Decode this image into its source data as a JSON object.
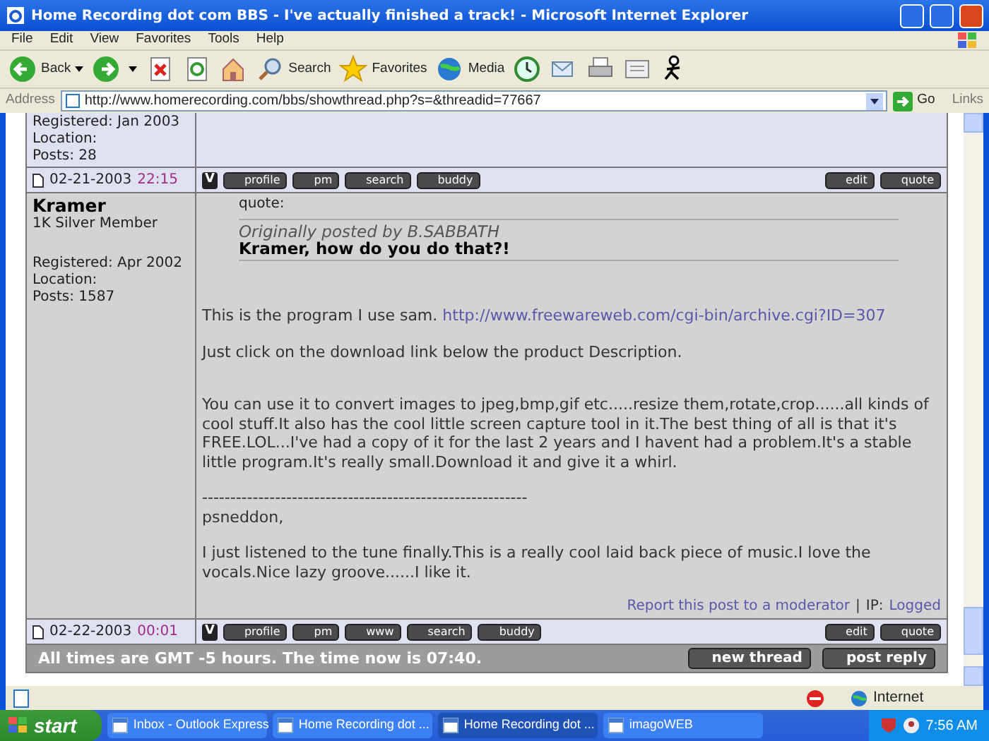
{
  "window": {
    "title": "Home Recording dot com BBS - I've actually finished a track! - Microsoft Internet Explorer"
  },
  "menu": [
    "File",
    "Edit",
    "View",
    "Favorites",
    "Tools",
    "Help"
  ],
  "toolbar": [
    {
      "kind": "back",
      "label": "Back"
    },
    {
      "kind": "forward"
    },
    {
      "kind": "stop"
    },
    {
      "kind": "refresh"
    },
    {
      "kind": "home"
    },
    {
      "kind": "search",
      "label": "Search"
    },
    {
      "kind": "favorites",
      "label": "Favorites"
    },
    {
      "kind": "media",
      "label": "Media"
    },
    {
      "kind": "history"
    },
    {
      "kind": "mail"
    },
    {
      "kind": "print"
    },
    {
      "kind": "edit"
    },
    {
      "kind": "messenger"
    }
  ],
  "address_bar": {
    "label": "Address",
    "url": "http://www.homerecording.com/bbs/showthread.php?s=&threadid=77667",
    "go": "Go",
    "links": "Links"
  },
  "posts": [
    {
      "author_details": [
        "Registered: Jan 2003",
        "Location:",
        "Posts: 28"
      ],
      "footer": {
        "date": "02-21-2003",
        "time": "22:15",
        "buttons": [
          "V",
          "profile",
          "pm",
          "search",
          "buddy"
        ],
        "right_buttons": [
          "edit",
          "quote"
        ]
      }
    },
    {
      "author": "Kramer",
      "rank": "1K Silver Member",
      "author_details": [
        "Registered: Apr 2002",
        "Location:",
        "Posts: 1587"
      ],
      "quote": {
        "label": "quote:",
        "attribution": "Originally posted by B.SABBATH",
        "text": "Kramer, how do you do that?!"
      },
      "body": [
        {
          "kind": "paragraph",
          "text": "This is the program I use sam.",
          "link": "http://www.freewareweb.com/cgi-bin/archive.cgi?ID=307"
        },
        {
          "kind": "paragraph-wide",
          "text": "Just click on the download link below the product Description."
        },
        {
          "kind": "paragraph",
          "text": "You can use it to convert images to jpeg,bmp,gif etc.....resize them,rotate,crop......all kinds of cool stuff.It also has the cool little screen capture tool in it.The best thing of all is that it's FREE.LOL...I've had a copy of it for the last 2 years and I havent had a problem.It's a stable little program.It's really small.Download it and give it a whirl."
        },
        {
          "kind": "line",
          "text": "----------------------------------------------------------"
        },
        {
          "kind": "paragraph",
          "text": "psneddon,"
        },
        {
          "kind": "paragraph",
          "text": "I just listened to the tune finally.This is a really cool laid back piece of music.I love the vocals.Nice lazy groove......I like it."
        }
      ],
      "report": {
        "link": "Report this post to a moderator",
        "separator": "|",
        "ip_label": "IP:",
        "ip_link": "Logged"
      },
      "footer": {
        "date": "02-22-2003",
        "time": "00:01",
        "buttons": [
          "V",
          "profile",
          "pm",
          "www",
          "search",
          "buddy"
        ],
        "right_buttons": [
          "edit",
          "quote"
        ]
      }
    }
  ],
  "thread_footer": {
    "text": "All times are GMT -5 hours. The time now is 07:40.",
    "buttons": [
      "new thread",
      "post reply"
    ]
  },
  "status_bar": {
    "zone": "Internet"
  },
  "taskbar": {
    "start": "start",
    "tasks": [
      {
        "label": "Inbox - Outlook Express",
        "selected": false
      },
      {
        "label": "Home Recording dot ...",
        "selected": false
      },
      {
        "label": "Home Recording dot ...",
        "selected": true
      },
      {
        "label": "imagoWEB",
        "selected": false
      }
    ],
    "clock": "7:56 AM"
  }
}
